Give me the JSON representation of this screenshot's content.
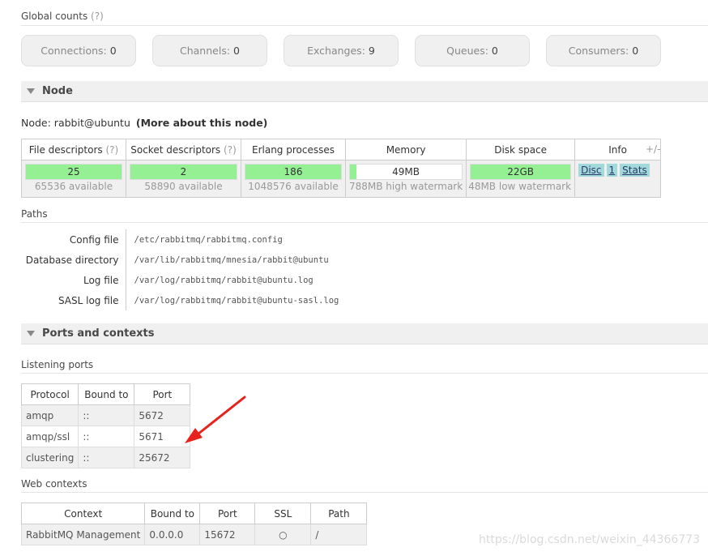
{
  "global": {
    "title": "Global counts",
    "help": "(?)"
  },
  "counts": [
    {
      "label": "Connections:",
      "value": "0"
    },
    {
      "label": "Channels:",
      "value": "0"
    },
    {
      "label": "Exchanges:",
      "value": "9"
    },
    {
      "label": "Queues:",
      "value": "0"
    },
    {
      "label": "Consumers:",
      "value": "0"
    }
  ],
  "node_section": {
    "title": "Node"
  },
  "node": {
    "prefix": "Node: rabbit@ubuntu",
    "more": "(More about this node)"
  },
  "node_table": {
    "headers": [
      "File descriptors",
      "Socket descriptors",
      "Erlang processes",
      "Memory",
      "Disk space",
      "Info"
    ],
    "header_help": "(?)",
    "cells": [
      {
        "value": "25",
        "sub": "65536 available",
        "fill": 1.0
      },
      {
        "value": "2",
        "sub": "58890 available",
        "fill": 1.0
      },
      {
        "value": "186",
        "sub": "1048576 available",
        "fill": 1.0
      },
      {
        "value": "49MB",
        "sub": "788MB high watermark",
        "fill": 0.06
      },
      {
        "value": "22GB",
        "sub": "48MB low watermark",
        "fill": 1.0
      }
    ],
    "info_buttons": [
      "Disc",
      "1",
      "Stats"
    ],
    "plusminus": "+/-"
  },
  "paths": {
    "title": "Paths",
    "rows": [
      {
        "key": "Config file",
        "value": "/etc/rabbitmq/rabbitmq.config"
      },
      {
        "key": "Database directory",
        "value": "/var/lib/rabbitmq/mnesia/rabbit@ubuntu"
      },
      {
        "key": "Log file",
        "value": "/var/log/rabbitmq/rabbit@ubuntu.log"
      },
      {
        "key": "SASL log file",
        "value": "/var/log/rabbitmq/rabbit@ubuntu-sasl.log"
      }
    ]
  },
  "ports_section": {
    "title": "Ports and contexts"
  },
  "listening": {
    "title": "Listening ports",
    "headers": [
      "Protocol",
      "Bound to",
      "Port"
    ],
    "rows": [
      [
        "amqp",
        "::",
        "5672"
      ],
      [
        "amqp/ssl",
        "::",
        "5671"
      ],
      [
        "clustering",
        "::",
        "25672"
      ]
    ]
  },
  "web": {
    "title": "Web contexts",
    "headers": [
      "Context",
      "Bound to",
      "Port",
      "SSL",
      "Path"
    ],
    "rows": [
      [
        "RabbitMQ Management",
        "0.0.0.0",
        "15672",
        "○",
        "/"
      ]
    ]
  },
  "watermark": "https://blog.csdn.net/weixin_44366773",
  "colors": {
    "bar_fill": "#94f093",
    "info_btn": "#a2d9db",
    "arrow": "#e8231e"
  }
}
